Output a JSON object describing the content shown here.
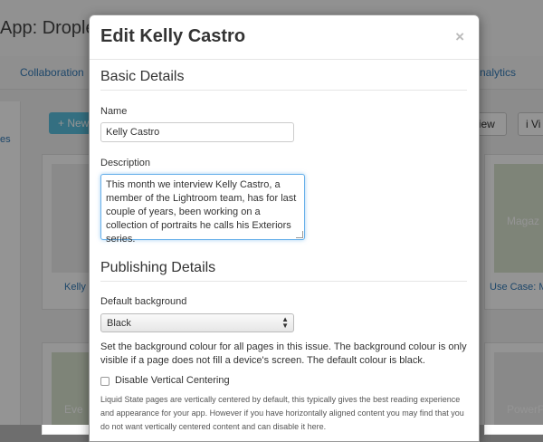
{
  "background": {
    "app_title": "App: Droplet",
    "tabs": [
      "Collaboration",
      "Analytics"
    ],
    "left_link": "es",
    "new_button": "+ New",
    "view_buttons": [
      "View",
      "i Vi"
    ],
    "card_labels": [
      "Kelly C",
      "Use Case: M"
    ],
    "tile_labels": [
      "Magaz",
      "Eve",
      "PowerP"
    ]
  },
  "modal": {
    "title": "Edit Kelly Castro",
    "close_icon": "×",
    "basic": {
      "heading": "Basic Details",
      "name_label": "Name",
      "name_value": "Kelly Castro",
      "description_label": "Description",
      "description_value": "This month we interview Kelly Castro, a member of the Lightroom team, has for last couple of years, been working on a collection of portraits he calls his Exteriors series."
    },
    "publishing": {
      "heading": "Publishing Details",
      "background_label": "Default background",
      "background_value": "Black",
      "background_help": "Set the background colour for all pages in this issue. The background colour is only visible if a page does not fill a device's screen. The default colour is black.",
      "centering_label": "Disable Vertical Centering",
      "centering_checked": false,
      "centering_help": "Liquid State pages are vertically centered by default, this typically gives the best reading experience and appearance for your app. However if you have horizontally aligned content you may find that you do not want vertically centered content and can disable it here."
    }
  }
}
